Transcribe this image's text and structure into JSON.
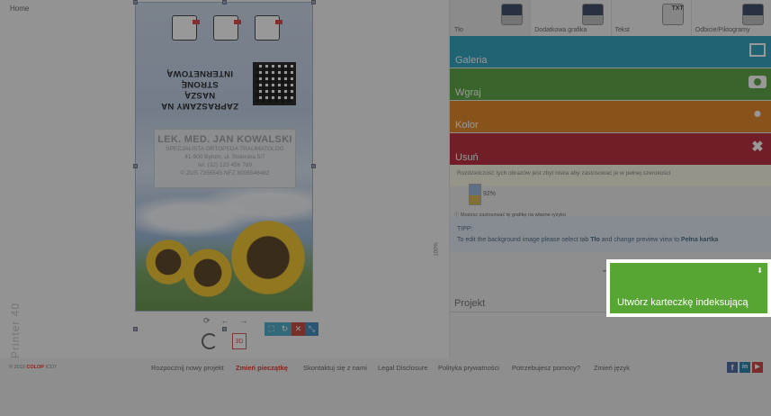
{
  "nav": {
    "home": "Home"
  },
  "workspace": {
    "vertical_label": "Printer 40",
    "zoom": "100%"
  },
  "card": {
    "invite_line1": "ZAPRASZAMY NA NASZĄ",
    "invite_line2": "STRONĘ INTERNETOWĄ",
    "name": "LEK. MED. JAN KOWALSKI",
    "lines": [
      "SPECJALISTA ORTOPEDA TRAUMATOLOG",
      "41-900 Bytom, ul. Srebrska 5/7",
      "tel. (32) 123 456 789",
      "© ZUS 7356545   NFZ 8006546482"
    ]
  },
  "tabs": [
    {
      "label": "Tło",
      "active": true
    },
    {
      "label": "Dodatkowa grafika",
      "active": false
    },
    {
      "label": "Tekst",
      "active": false,
      "icon_text": "TXT"
    },
    {
      "label": "Odbicie/Piktogramy",
      "active": false
    }
  ],
  "actions": [
    {
      "label": "Galeria",
      "color": "#1a9ab8",
      "icon": "image-icon"
    },
    {
      "label": "Wgraj",
      "color": "#4a9c2f",
      "icon": "camera-icon"
    },
    {
      "label": "Kolor",
      "color": "#e07b10",
      "icon": "drop-icon"
    },
    {
      "label": "Usuń",
      "color": "#b5162a",
      "icon": "close-icon"
    }
  ],
  "resolution_note": "Rozdzielczość tych obrazów jest zbyt niska aby zastosować je w pełnej szerokości",
  "percent": "92%",
  "hint": "Możesz zastosować tę grafikę na własne ryzyko",
  "tip": {
    "title": "TIPP:",
    "text_before": "To edit the background image please select tab ",
    "tab_name": "Tło",
    "text_middle": " and change preview view to ",
    "view_name": "Pełna kartka"
  },
  "project_label": "Projekt",
  "index_button": "Utwórz karteczkę indeksującą",
  "footer": {
    "copyright_year": "© 2019",
    "brand": "COLOP",
    "brand_suffix": "ICD7",
    "links": [
      "Rozpocznij nowy projekt",
      "Zmień pieczątkę",
      "Skontaktuj się z nami",
      "Legal Disclosure",
      "Polityka prywatności",
      "Potrzebujesz pomocy?",
      "Zmień język"
    ]
  },
  "colors": {
    "accent_green": "#57a533",
    "teal": "#1a9ab8",
    "orange": "#e07b10",
    "red": "#b5162a"
  }
}
